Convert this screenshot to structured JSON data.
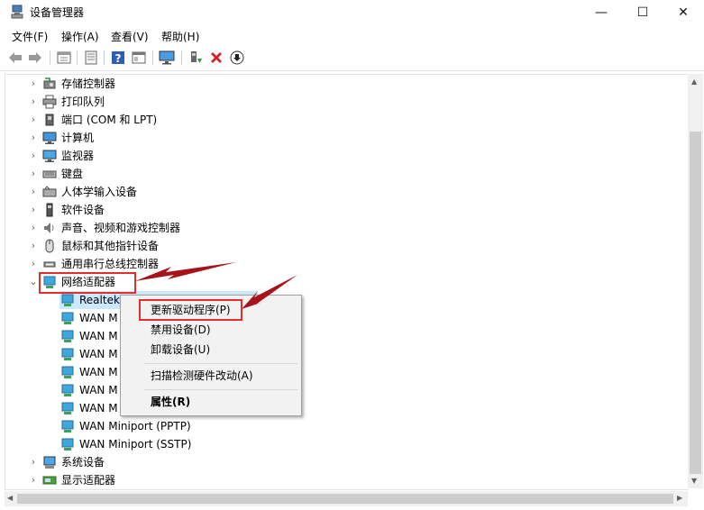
{
  "window": {
    "title": "设备管理器",
    "controls": {
      "minimize": "—",
      "maximize": "☐",
      "close": "✕"
    }
  },
  "menu": [
    "文件(F)",
    "操作(A)",
    "查看(V)",
    "帮助(H)"
  ],
  "toolbar": {
    "icons": [
      "back-icon",
      "forward-icon",
      "properties-icon",
      "computer-icon",
      "help-icon",
      "view-icon",
      "monitor-icon",
      "add-driver-icon",
      "uninstall-icon",
      "update-icon"
    ]
  },
  "tree": {
    "categories": [
      {
        "label": "存储控制器",
        "expanded": false
      },
      {
        "label": "打印队列",
        "expanded": false
      },
      {
        "label": "端口 (COM 和 LPT)",
        "expanded": false
      },
      {
        "label": "计算机",
        "expanded": false
      },
      {
        "label": "监视器",
        "expanded": false
      },
      {
        "label": "键盘",
        "expanded": false
      },
      {
        "label": "人体学输入设备",
        "expanded": false
      },
      {
        "label": "软件设备",
        "expanded": false
      },
      {
        "label": "声音、视频和游戏控制器",
        "expanded": false
      },
      {
        "label": "鼠标和其他指针设备",
        "expanded": false
      },
      {
        "label": "通用串行总线控制器",
        "expanded": false
      },
      {
        "label": "网络适配器",
        "expanded": true
      }
    ],
    "network_children": [
      "Realtek PCIe GBE Family Controller",
      "WAN M",
      "WAN M",
      "WAN M",
      "WAN M",
      "WAN M",
      "WAN M",
      "WAN Miniport (PPTP)",
      "WAN Miniport (SSTP)"
    ],
    "after": [
      {
        "label": "系统设备",
        "expanded": false
      },
      {
        "label": "显示适配器",
        "expanded": false
      }
    ]
  },
  "context_menu": {
    "items": [
      "更新驱动程序(P)",
      "禁用设备(D)",
      "卸载设备(U)",
      "扫描检测硬件改动(A)",
      "属性(R)"
    ]
  },
  "colors": {
    "highlight": "#e0302b",
    "arrow": "#a8131b",
    "selection": "#cce8ff"
  }
}
